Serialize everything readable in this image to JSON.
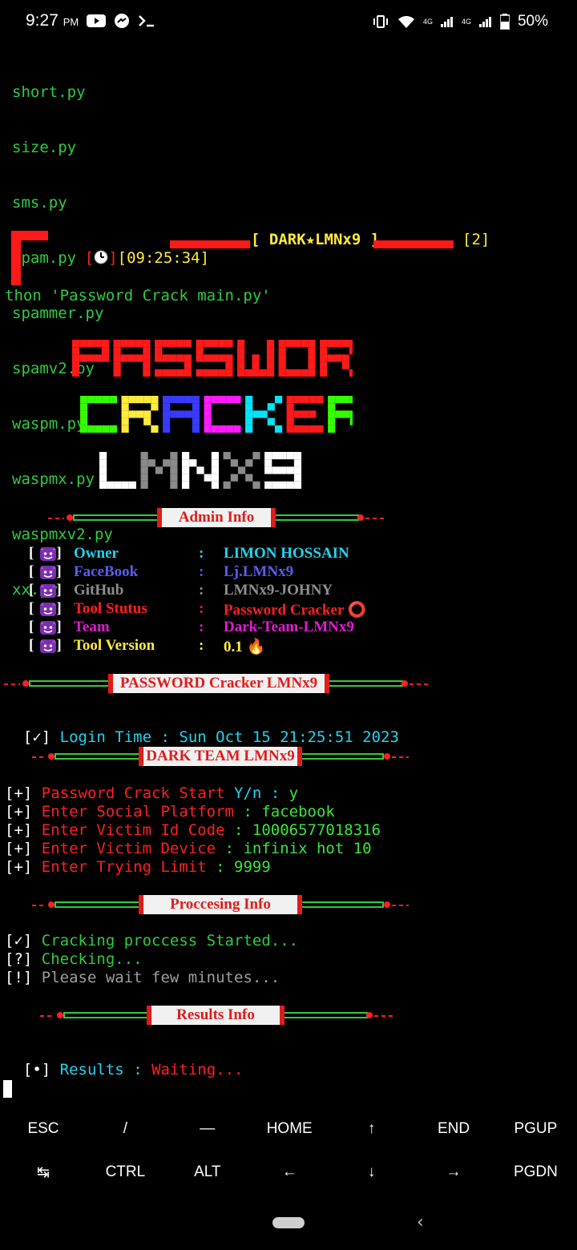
{
  "status_bar": {
    "time": "9:27",
    "ampm": "PM",
    "network": "4G",
    "network2": "4G",
    "battery": "50%"
  },
  "terminal": {
    "files": [
      "short.py",
      "size.py",
      "sms.py",
      "spam.py",
      "spammer.py",
      "spamv2.py",
      "waspm.py",
      "waspmx.py",
      "waspmxv2.py",
      "xx.py"
    ],
    "prompt": {
      "time": "[09:25:34]",
      "title": "[ DARK★LMNx9 ]",
      "count": "[2]"
    },
    "command": "thon 'Password Crack main.py'",
    "banner_lines": [
      "PASSWORD",
      "CRACKER",
      "LMNX9"
    ],
    "admin_header": "Admin Info",
    "admin_rows": [
      {
        "key": "Owner",
        "value": "LIMON HOSSAIN",
        "color": "#21d4ee"
      },
      {
        "key": "FaceBook",
        "value": "Lĵ.LMNx9",
        "color": "#5a5cf0"
      },
      {
        "key": "GitHub",
        "value": "LMNx9-JOHNY",
        "color": "#8e8e8e"
      },
      {
        "key": "Tool Stutus",
        "value": "Password Cracker ⭕",
        "color": "#ff2020"
      },
      {
        "key": "Team",
        "value": "Dark-Team-LMNx9",
        "color": "#e21bd0"
      },
      {
        "key": "Tool Version",
        "value": "0.1 🔥",
        "color": "#ffeb3b"
      }
    ],
    "colon": ":",
    "bracket_open": "[",
    "bracket_close": "]",
    "section2_header": "PASSWORD Cracker LMNx9",
    "login": {
      "tag": "[✓]",
      "label": "Login Time",
      "sep": " : ",
      "value": "Sun Oct 15 21:25:51 2023"
    },
    "section3_header": "DARK TEAM LMNx9",
    "inputs": [
      {
        "tag": "[+]",
        "label": "Password Crack Start",
        "prompt": " Y/n : ",
        "value": "y"
      },
      {
        "tag": "[+]",
        "label": "Enter Social Platform",
        "prompt": " : ",
        "value": "facebook"
      },
      {
        "tag": "[+]",
        "label": "Enter Victim Id Code",
        "prompt": " : ",
        "value": "10006577018316"
      },
      {
        "tag": "[+]",
        "label": "Enter Victim Device",
        "prompt": " : ",
        "value": "infinix hot 10"
      },
      {
        "tag": "[+]",
        "label": "Enter Trying Limit",
        "prompt": " : ",
        "value": "9999"
      }
    ],
    "section4_header": "Proccesing Info",
    "processing": [
      {
        "tag": "[✓]",
        "text": "Cracking proccess Started...",
        "color": "#2ecc40"
      },
      {
        "tag": "[?]",
        "text": "Checking...",
        "color": "#2ecc40"
      },
      {
        "tag": "[!]",
        "text": "Please wait few minutes...",
        "color": "#9e9e9e"
      }
    ],
    "section5_header": "Results Info",
    "results": {
      "tag": "[•]",
      "label": "Results",
      "sep": " : ",
      "value": "Waiting..."
    }
  },
  "extra_keys": {
    "row1": [
      "ESC",
      "/",
      "—",
      "HOME",
      "↑",
      "END",
      "PGUP"
    ],
    "row2": [
      "↹",
      "CTRL",
      "ALT",
      "←",
      "↓",
      "→",
      "PGDN"
    ]
  },
  "colors": {
    "terminal_green": "#2ecc40",
    "terminal_red": "#ff2020",
    "terminal_cyan": "#21d4ee",
    "terminal_yellow": "#ffeb3b"
  }
}
